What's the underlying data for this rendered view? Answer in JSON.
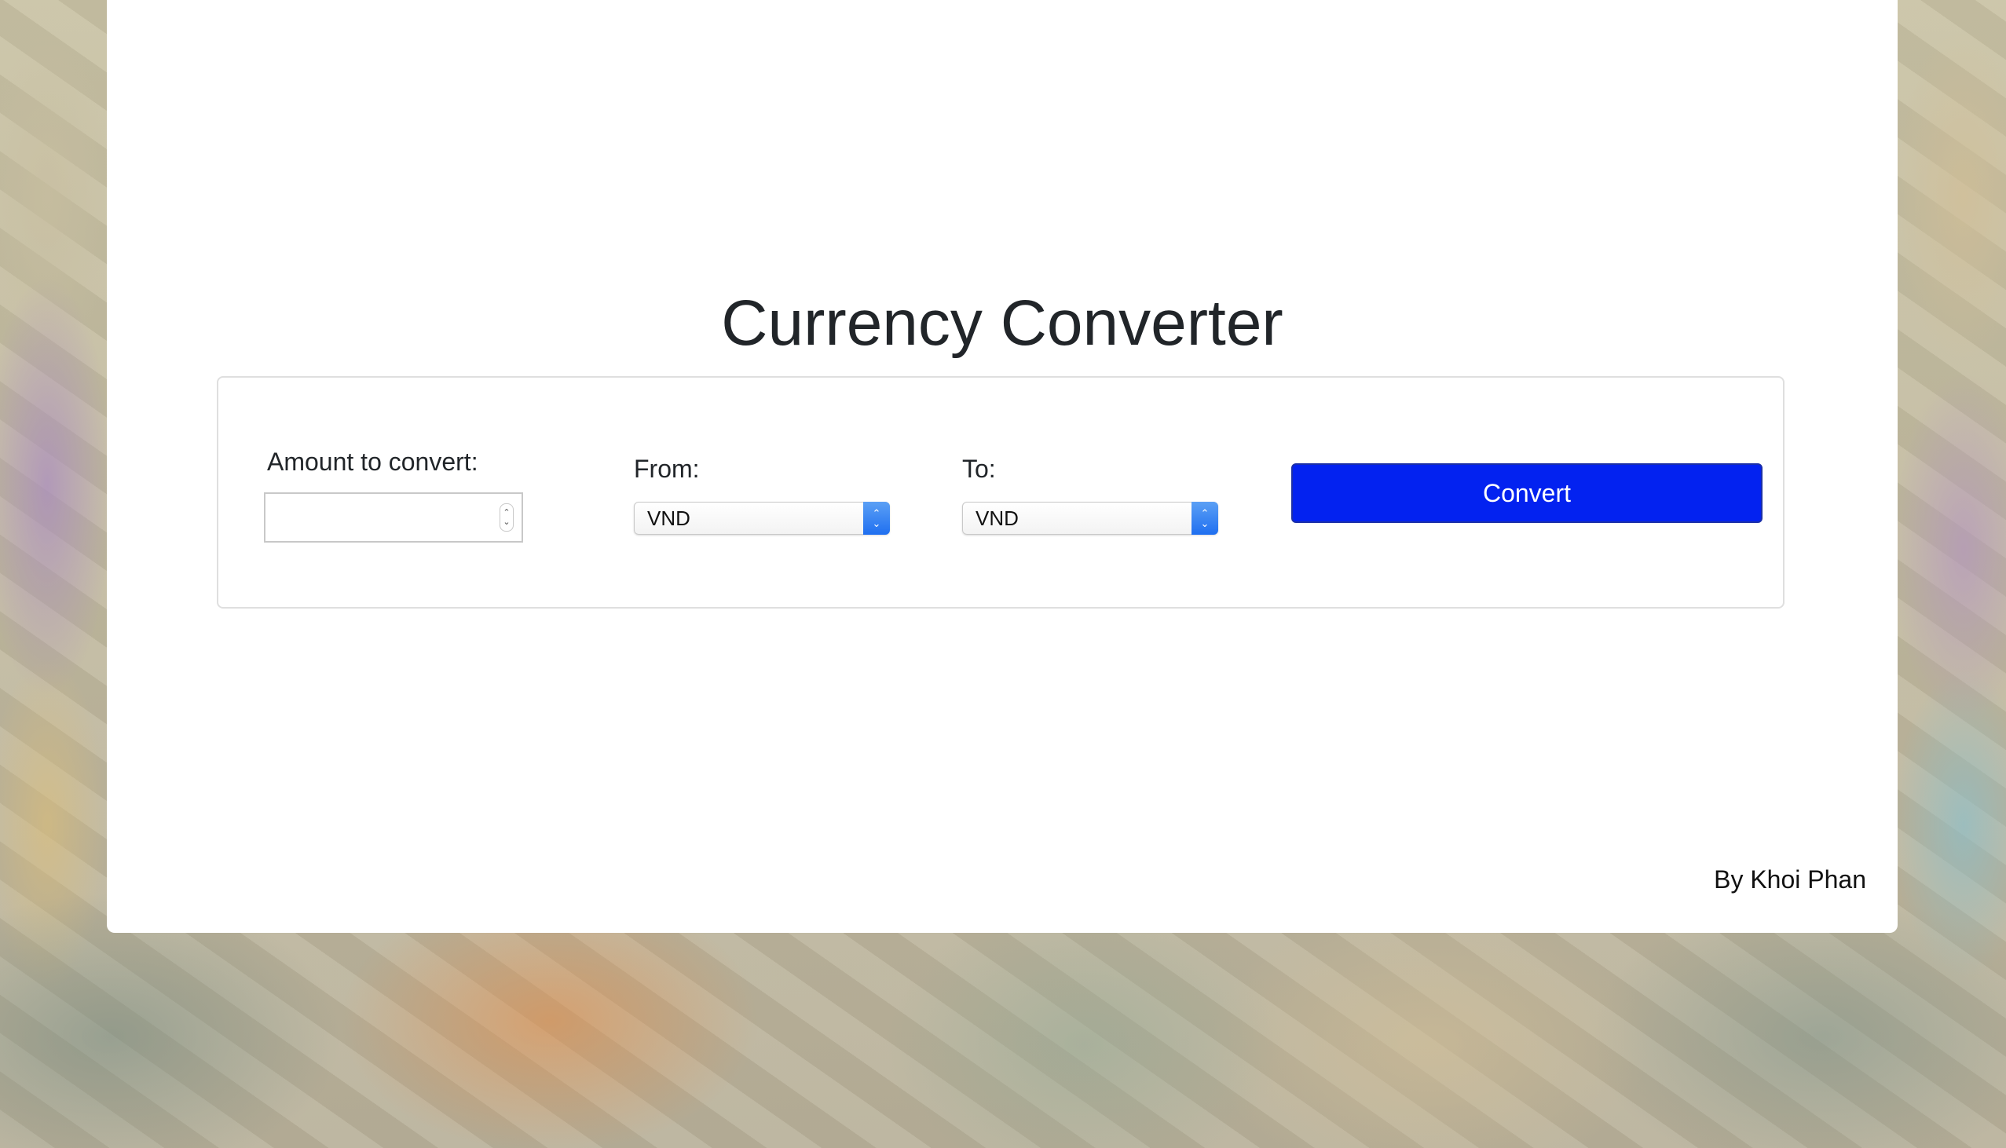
{
  "page": {
    "title": "Currency Converter",
    "footer_author": "By Khoi Phan"
  },
  "form": {
    "amount_label": "Amount to convert:",
    "amount_value": "",
    "from_label": "From:",
    "from_selected": "VND",
    "to_label": "To:",
    "to_selected": "VND",
    "convert_label": "Convert"
  },
  "icons": {
    "stepper": "stepper-arrows-icon",
    "select": "chevron-updown-icon"
  },
  "colors": {
    "button": "#0322f0",
    "select_accent": "#1f6ff0"
  }
}
